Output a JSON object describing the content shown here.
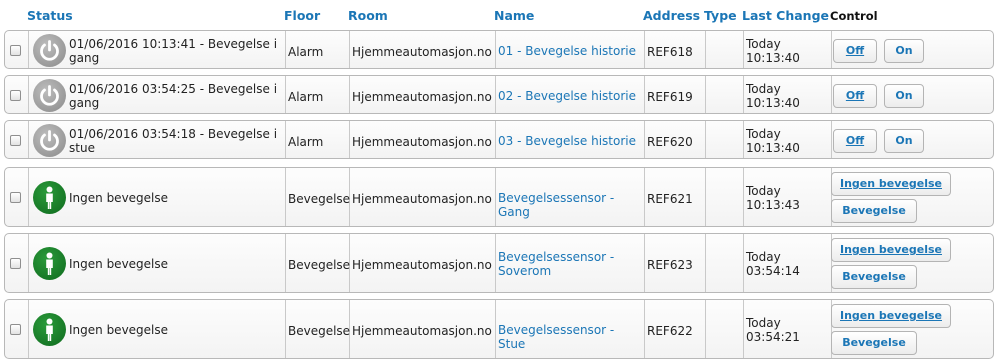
{
  "header": {
    "status": "Status",
    "floor": "Floor",
    "room": "Room",
    "name": "Name",
    "address": "Address",
    "type": "Type",
    "last_change": "Last Change",
    "control": "Control"
  },
  "colors": {
    "link": "#1b76b6",
    "power_icon": "#9a9a9a",
    "person_icon": "#177a27"
  },
  "rows": [
    {
      "icon": "power-icon",
      "status": "01/06/2016 10:13:41 - Bevegelse i gang",
      "floor": "Alarm",
      "room": "Hjemmeautomasjon.no",
      "name": "01 - Bevegelse historie",
      "address": "REF618",
      "type": "",
      "last_change": [
        "Today",
        "10:13:40"
      ],
      "buttons": [
        "Off",
        "On"
      ]
    },
    {
      "icon": "power-icon",
      "status": "01/06/2016 03:54:25 - Bevegelse i gang",
      "floor": "Alarm",
      "room": "Hjemmeautomasjon.no",
      "name": "02 - Bevegelse historie",
      "address": "REF619",
      "type": "",
      "last_change": [
        "Today",
        "10:13:40"
      ],
      "buttons": [
        "Off",
        "On"
      ]
    },
    {
      "icon": "power-icon",
      "status": "01/06/2016 03:54:18 - Bevegelse i stue",
      "floor": "Alarm",
      "room": "Hjemmeautomasjon.no",
      "name": "03 - Bevegelse historie",
      "address": "REF620",
      "type": "",
      "last_change": [
        "Today",
        "10:13:40"
      ],
      "buttons": [
        "Off",
        "On"
      ]
    },
    {
      "icon": "person-icon",
      "status": "Ingen bevegelse",
      "floor": "Bevegelse",
      "room": "Hjemmeautomasjon.no",
      "name": "Bevegelsessensor - Gang",
      "address": "REF621",
      "type": "",
      "last_change": [
        "Today",
        "10:13:43"
      ],
      "buttons": [
        "Ingen bevegelse",
        "Bevegelse"
      ]
    },
    {
      "icon": "person-icon",
      "status": "Ingen bevegelse",
      "floor": "Bevegelse",
      "room": "Hjemmeautomasjon.no",
      "name": "Bevegelsessensor - Soverom",
      "address": "REF623",
      "type": "",
      "last_change": [
        "Today",
        "03:54:14"
      ],
      "buttons": [
        "Ingen bevegelse",
        "Bevegelse"
      ]
    },
    {
      "icon": "person-icon",
      "status": "Ingen bevegelse",
      "floor": "Bevegelse",
      "room": "Hjemmeautomasjon.no",
      "name": "Bevegelsessensor - Stue",
      "address": "REF622",
      "type": "",
      "last_change": [
        "Today",
        "03:54:21"
      ],
      "buttons": [
        "Ingen bevegelse",
        "Bevegelse"
      ]
    }
  ]
}
